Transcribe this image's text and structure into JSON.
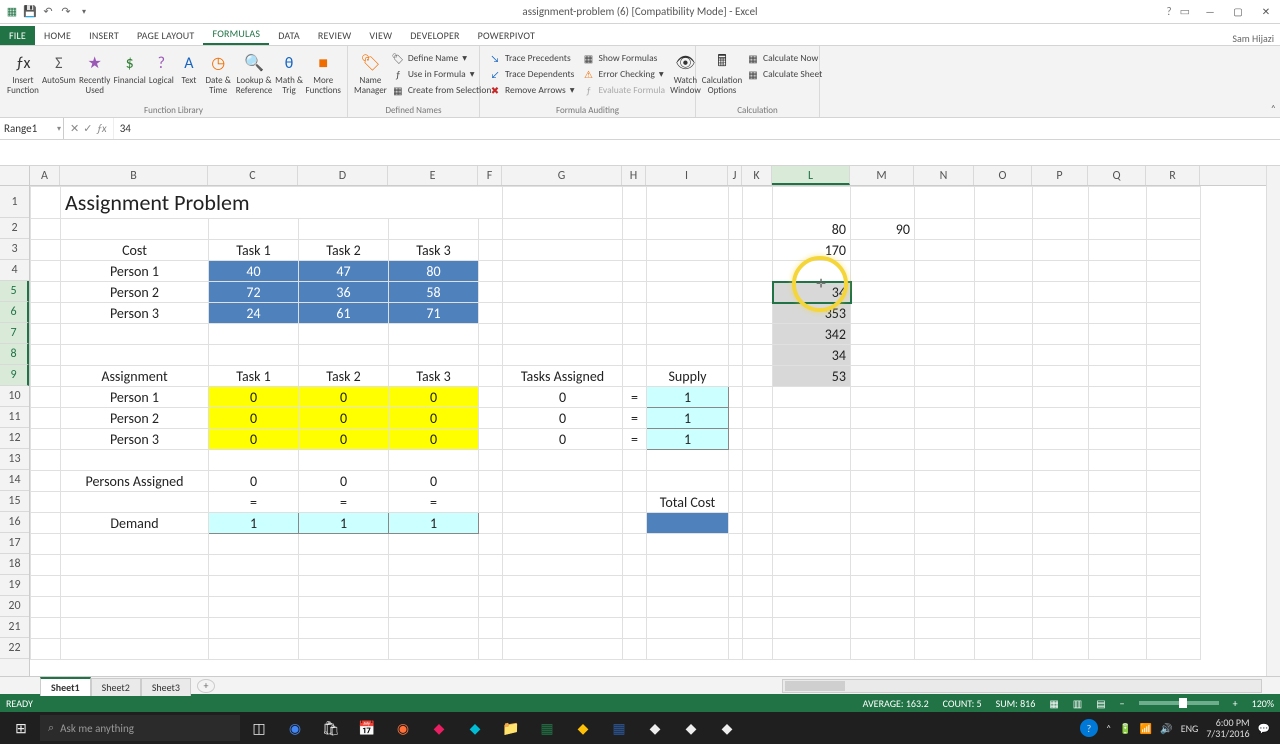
{
  "app": {
    "title": "assignment-problem (6)  [Compatibility Mode] - Excel",
    "user": "Sam Hijazi"
  },
  "tabs": {
    "file": "FILE",
    "list": [
      "HOME",
      "INSERT",
      "PAGE LAYOUT",
      "FORMULAS",
      "DATA",
      "REVIEW",
      "VIEW",
      "DEVELOPER",
      "POWERPIVOT"
    ],
    "active": "FORMULAS"
  },
  "ribbon": {
    "groups": {
      "function_library": {
        "label": "Function Library",
        "insert_function": "Insert Function",
        "autosum": "AutoSum",
        "recently_used": "Recently Used",
        "financial": "Financial",
        "logical": "Logical",
        "text": "Text",
        "date_time": "Date & Time",
        "lookup_ref": "Lookup & Reference",
        "math_trig": "Math & Trig",
        "more": "More Functions"
      },
      "defined_names": {
        "label": "Defined Names",
        "name_manager": "Name Manager",
        "define_name": "Define Name",
        "use_in_formula": "Use in Formula",
        "create_from_selection": "Create from Selection"
      },
      "formula_auditing": {
        "label": "Formula Auditing",
        "trace_precedents": "Trace Precedents",
        "trace_dependents": "Trace Dependents",
        "remove_arrows": "Remove Arrows",
        "show_formulas": "Show Formulas",
        "error_checking": "Error Checking",
        "evaluate_formula": "Evaluate Formula",
        "watch_window": "Watch Window"
      },
      "calculation": {
        "label": "Calculation",
        "options": "Calculation Options",
        "calc_now": "Calculate Now",
        "calc_sheet": "Calculate Sheet"
      }
    }
  },
  "namebox": "Range1",
  "formula": "34",
  "columns": [
    "A",
    "B",
    "C",
    "D",
    "E",
    "F",
    "G",
    "H",
    "I",
    "J",
    "K",
    "L",
    "M",
    "N",
    "O",
    "P",
    "Q",
    "R"
  ],
  "rows": [
    "1",
    "2",
    "3",
    "4",
    "5",
    "6",
    "7",
    "8",
    "9",
    "10",
    "11",
    "12",
    "13",
    "14",
    "15",
    "16",
    "17",
    "18",
    "19",
    "20",
    "21",
    "22"
  ],
  "active_col": "L",
  "active_rows": [
    "5",
    "6",
    "7",
    "8",
    "9"
  ],
  "sheet": {
    "title": "Assignment Problem",
    "cost_label": "Cost",
    "tasks": [
      "Task 1",
      "Task 2",
      "Task 3"
    ],
    "persons": [
      "Person 1",
      "Person 2",
      "Person 3"
    ],
    "cost_matrix": [
      [
        40,
        47,
        80
      ],
      [
        72,
        36,
        58
      ],
      [
        24,
        61,
        71
      ]
    ],
    "assignment_label": "Assignment",
    "assignment_matrix": [
      [
        0,
        0,
        0
      ],
      [
        0,
        0,
        0
      ],
      [
        0,
        0,
        0
      ]
    ],
    "tasks_assigned_label": "Tasks Assigned",
    "tasks_assigned": [
      0,
      0,
      0
    ],
    "eq": "=",
    "supply_label": "Supply",
    "supply": [
      1,
      1,
      1
    ],
    "persons_assigned_label": "Persons Assigned",
    "persons_assigned": [
      0,
      0,
      0
    ],
    "eq_row": [
      "=",
      "=",
      "="
    ],
    "demand_label": "Demand",
    "demand": [
      1,
      1,
      1
    ],
    "total_cost_label": "Total Cost",
    "side": {
      "L2": 80,
      "M2": 90,
      "L3": 170,
      "L5": 34,
      "L6": 353,
      "L7": 342,
      "L8": 34,
      "L9": 53
    }
  },
  "sheet_tabs": [
    "Sheet1",
    "Sheet2",
    "Sheet3"
  ],
  "status": {
    "ready": "READY",
    "average": "AVERAGE: 163.2",
    "count": "COUNT: 5",
    "sum": "SUM: 816",
    "zoom": "120%"
  },
  "taskbar": {
    "search_placeholder": "Ask me anything",
    "time": "6:00 PM",
    "date": "7/31/2016",
    "lang": "ENG"
  }
}
